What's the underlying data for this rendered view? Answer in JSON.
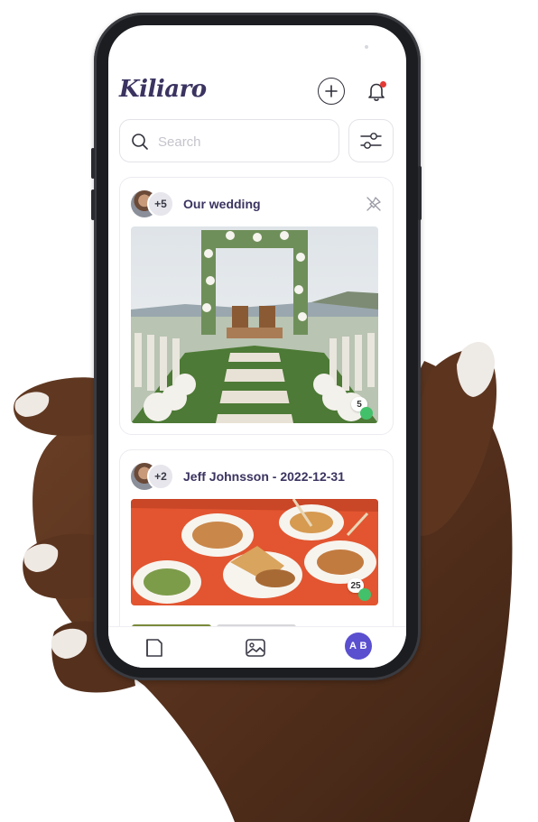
{
  "app": {
    "logo": "Kiliaro"
  },
  "search": {
    "placeholder": "Search"
  },
  "albums": [
    {
      "title": "Our wedding",
      "extra_members": "+5",
      "count": "5"
    },
    {
      "title": "Jeff Johnsson - 2022-12-31",
      "extra_members": "+2",
      "count": "25"
    }
  ],
  "nav": {
    "user_initials": "A B"
  },
  "colors": {
    "brand": "#3b3360",
    "accent": "#5a4fcf",
    "notification": "#e53935"
  },
  "icons": [
    "plus-icon",
    "bell-icon",
    "search-icon",
    "filter-icon",
    "pin-icon",
    "album-icon",
    "gallery-icon"
  ]
}
